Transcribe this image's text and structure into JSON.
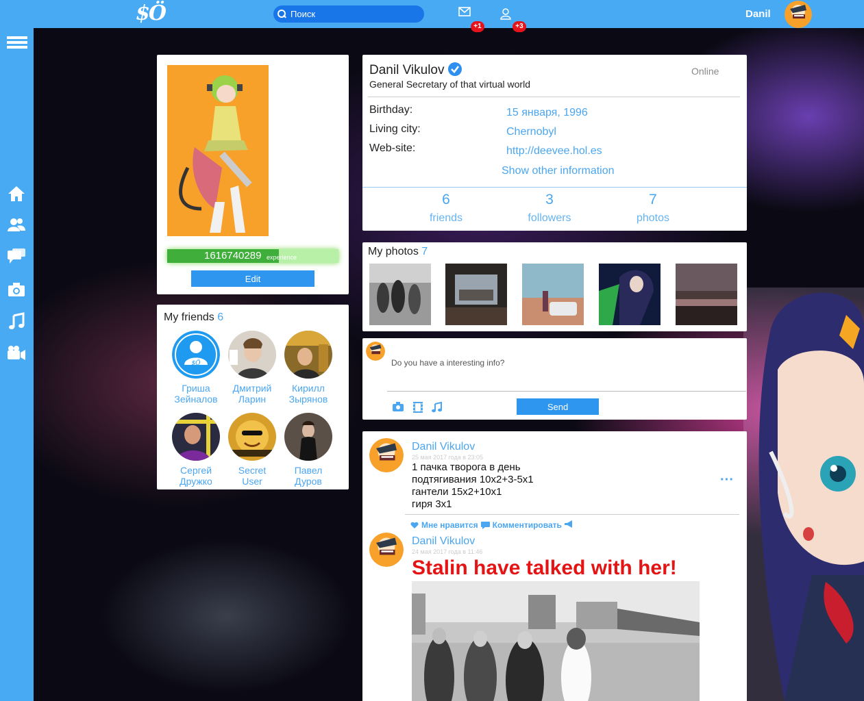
{
  "topbar": {
    "logo": "$Ö",
    "search_placeholder": "Поиск",
    "messages_badge": "+1",
    "friends_badge": "+3",
    "user_name": "Danil"
  },
  "sidebar": {
    "items": [
      "menu-icon",
      "home-icon",
      "users-icon",
      "chat-icon",
      "camera-icon",
      "music-icon",
      "video-icon"
    ]
  },
  "profile_card": {
    "experience_value": "1616740289",
    "experience_label": "experience",
    "experience_fill": 0.65,
    "edit_label": "Edit"
  },
  "friends_card": {
    "title": "My friends",
    "count": "6",
    "friends": [
      {
        "first": "Гриша",
        "last": "Зейналов"
      },
      {
        "first": "Дмитрий",
        "last": "Ларин"
      },
      {
        "first": "Кирилл",
        "last": "Зырянов"
      },
      {
        "first": "Сергей",
        "last": "Дружко"
      },
      {
        "first": "Secret",
        "last": "User"
      },
      {
        "first": "Павел",
        "last": "Дуров"
      }
    ],
    "default_avatar_text": "$Ö"
  },
  "info_card": {
    "name": "Danil Vikulov",
    "status": "General Secretary of that virtual world",
    "online": "Online",
    "birthday_label": "Birthday:",
    "birthday_value": "15 января, 1996",
    "city_label": "Living city:",
    "city_value": "Chernobyl",
    "website_label": "Web-site:",
    "website_value": "http://deevee.hol.es",
    "show_more": "Show other information",
    "stats": [
      {
        "num": "6",
        "label": "friends"
      },
      {
        "num": "3",
        "label": "followers"
      },
      {
        "num": "7",
        "label": "photos"
      }
    ]
  },
  "photos_card": {
    "title": "My photos",
    "count": "7"
  },
  "post_box": {
    "placeholder": "Do you have a interesting info?",
    "send_label": "Send"
  },
  "feed": {
    "posts": [
      {
        "author": "Danil Vikulov",
        "date": "25 мая 2017 года в 23:05",
        "lines": [
          "1 пачка творога в день",
          "подтягивания 10х2+3-5х1",
          "гантели 15х2+10х1",
          "гиря 3х1"
        ],
        "more": "···"
      },
      {
        "author": "Danil Vikulov",
        "date": "24 мая 2017 года в 11:46",
        "headline": "Stalin have talked with her!"
      }
    ],
    "like_label": "Мне нравится",
    "comment_label": "Комментировать"
  },
  "colors": {
    "accent": "#47aaf3",
    "link": "#4aa6f0",
    "badge": "#e5141c",
    "headline": "#e41414"
  }
}
